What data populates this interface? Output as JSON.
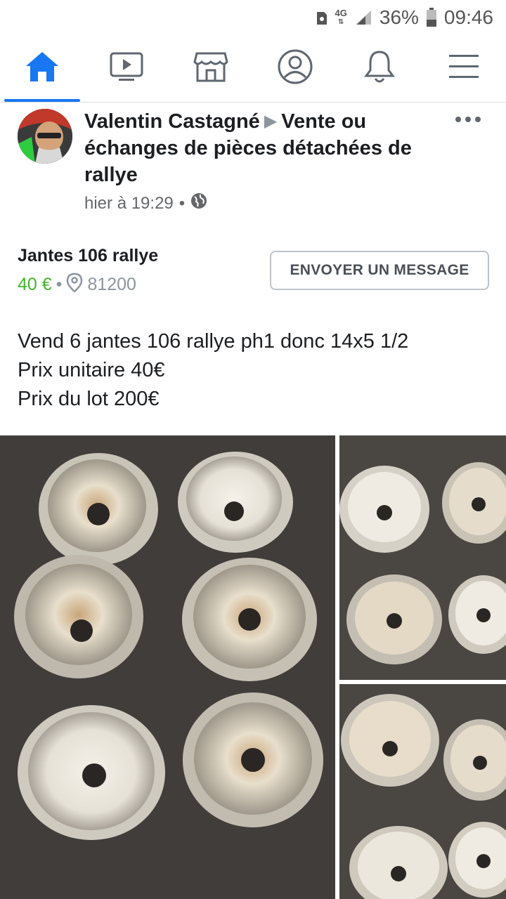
{
  "status_bar": {
    "network": "4G",
    "battery": "36%",
    "time": "09:46",
    "icons": [
      "sim-icon",
      "signal-icon",
      "battery-icon"
    ]
  },
  "nav": {
    "tabs": [
      {
        "name": "home",
        "icon": "home-icon",
        "active": true
      },
      {
        "name": "watch",
        "icon": "video-icon",
        "active": false
      },
      {
        "name": "marketplace",
        "icon": "store-icon",
        "active": false
      },
      {
        "name": "profile",
        "icon": "profile-icon",
        "active": false
      },
      {
        "name": "notifications",
        "icon": "bell-icon",
        "active": false
      },
      {
        "name": "menu",
        "icon": "hamburger-icon",
        "active": false
      }
    ],
    "accent": "#1877f2"
  },
  "post": {
    "author": "Valentin Castagné",
    "group": "Vente ou échanges de pièces détachées de rallye",
    "time": "hier à 19:29",
    "separator": "•",
    "privacy_icon": "globe-icon"
  },
  "listing": {
    "title": "Jantes 106 rallye",
    "price": "40 €",
    "separator": "•",
    "location": "81200",
    "price_color": "#42b72a",
    "message_button": "ENVOYER UN MESSAGE"
  },
  "description": [
    "Vend 6 jantes 106 rallye ph1 donc 14x5 1/2",
    "Prix unitaire 40€",
    "Prix du lot 200€"
  ]
}
